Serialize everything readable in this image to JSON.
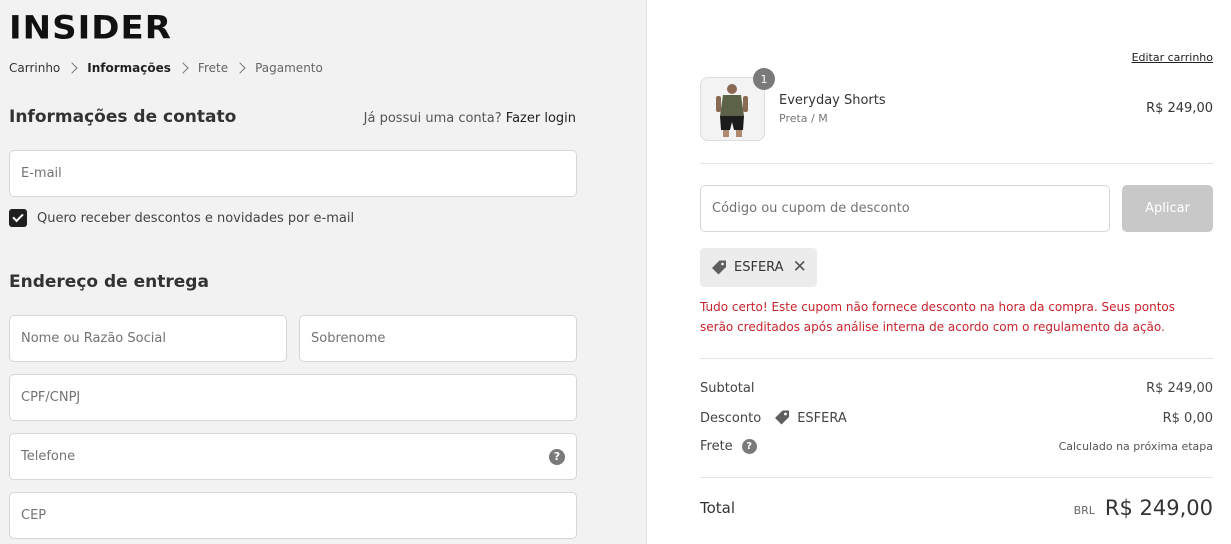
{
  "brand": {
    "logo": "INSIDER"
  },
  "breadcrumb": [
    "Carrinho",
    "Informações",
    "Frete",
    "Pagamento"
  ],
  "contact": {
    "title": "Informações de contato",
    "login_prompt": "Já possui uma conta?",
    "login_link": "Fazer login",
    "email_placeholder": "E-mail",
    "newsletter_label": "Quero receber descontos e novidades por e-mail",
    "newsletter_checked": true
  },
  "shipping": {
    "title": "Endereço de entrega",
    "first_name_placeholder": "Nome ou Razão Social",
    "last_name_placeholder": "Sobrenome",
    "doc_placeholder": "CPF/CNPJ",
    "phone_placeholder": "Telefone",
    "zip_placeholder": "CEP"
  },
  "cart": {
    "edit_label": "Editar carrinho",
    "item": {
      "quantity": "1",
      "name": "Everyday Shorts",
      "variant": "Preta / M",
      "price": "R$ 249,00"
    },
    "coupon_placeholder": "Código ou cupom de desconto",
    "apply_label": "Aplicar",
    "applied_code": "ESFERA",
    "notice": "Tudo certo! Este cupom não fornece desconto na hora da compra. Seus pontos serão creditados após análise interna de acordo com o regulamento da ação.",
    "subtotal_label": "Subtotal",
    "subtotal_value": "R$ 249,00",
    "discount_label": "Desconto",
    "discount_code": "ESFERA",
    "discount_value": "R$ 0,00",
    "shipping_label": "Frete",
    "shipping_value": "Calculado na próxima etapa",
    "total_label": "Total",
    "total_currency": "BRL",
    "total_value": "R$ 249,00"
  },
  "colors": {
    "error": "#c8232c",
    "left_bg": "#f2f2f2"
  }
}
